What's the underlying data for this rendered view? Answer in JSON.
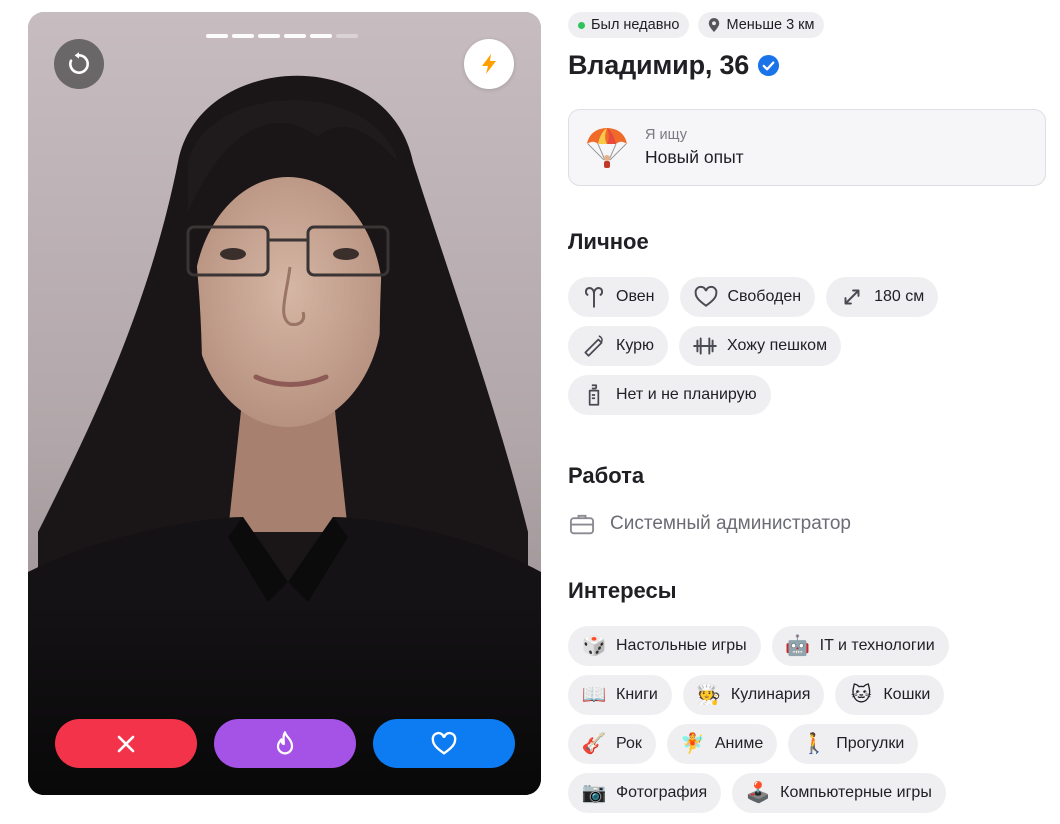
{
  "photo": {
    "progress_total": 6,
    "progress_active": 5
  },
  "actions": {
    "undo_icon": "undo-icon",
    "boost_icon": "lightning-icon",
    "dislike_icon": "close-icon",
    "superlike_icon": "flame-icon",
    "like_icon": "heart-icon"
  },
  "colors": {
    "dislike": "#f2334a",
    "superlike": "#a552e6",
    "like": "#0d7cf2",
    "online": "#2ec35c",
    "verified": "#1a73e8",
    "boost": "#ffa000"
  },
  "profile": {
    "status": "Был недавно",
    "distance": "Меньше 3 км",
    "name": "Владимир, 36",
    "verified": true
  },
  "seeking": {
    "caption": "Я ищу",
    "value": "Новый опыт",
    "emoji": "parachute-emoji"
  },
  "personal": {
    "title": "Личное",
    "chips": [
      {
        "icon": "aries-icon",
        "label": "Овен"
      },
      {
        "icon": "heart-outline-icon",
        "label": "Свободен"
      },
      {
        "icon": "height-arrows-icon",
        "label": "180 см"
      },
      {
        "icon": "cigarette-icon",
        "label": "Курю"
      },
      {
        "icon": "dumbbell-icon",
        "label": "Хожу пешком"
      },
      {
        "icon": "baby-bottle-icon",
        "label": "Нет и не планирую"
      }
    ]
  },
  "work": {
    "title": "Работа",
    "icon": "briefcase-icon",
    "job": "Системный администратор"
  },
  "interests": {
    "title": "Интересы",
    "chips": [
      {
        "icon": "🎲",
        "label": "Настольные игры"
      },
      {
        "icon": "🤖",
        "label": "IT и технологии"
      },
      {
        "icon": "📖",
        "label": "Книги"
      },
      {
        "icon": "🧑‍🍳",
        "label": "Кулинария"
      },
      {
        "icon": "🐱",
        "label": "Кошки"
      },
      {
        "icon": "🎸",
        "label": "Рок"
      },
      {
        "icon": "🧚",
        "label": "Аниме"
      },
      {
        "icon": "🚶",
        "label": "Прогулки"
      },
      {
        "icon": "📷",
        "label": "Фотография"
      },
      {
        "icon": "🕹️",
        "label": "Компьютерные игры"
      }
    ]
  }
}
